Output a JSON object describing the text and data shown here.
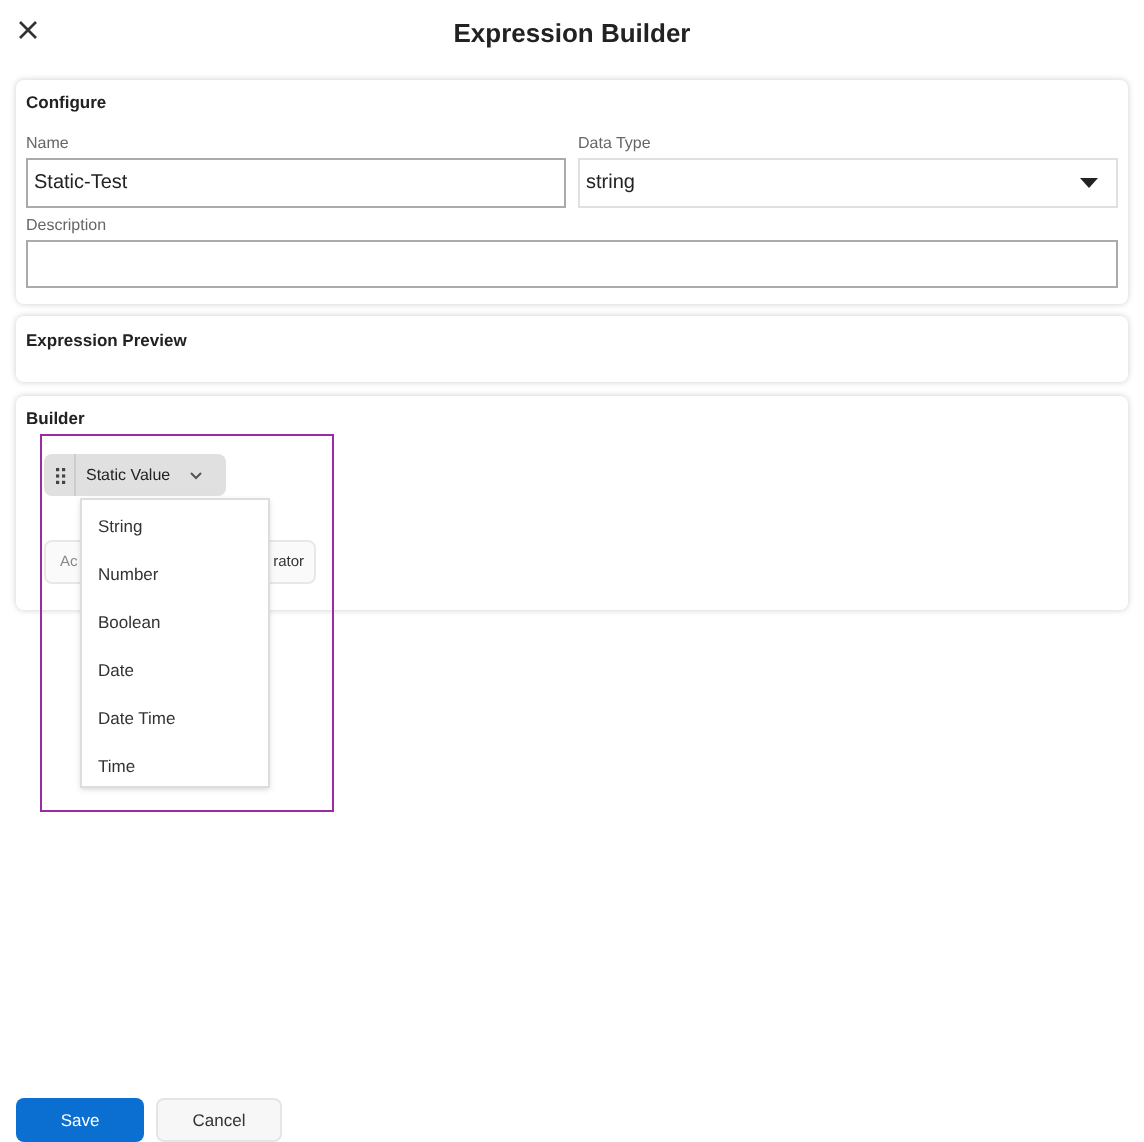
{
  "window": {
    "title": "Expression Builder"
  },
  "configure": {
    "heading": "Configure",
    "name_label": "Name",
    "name_value": "Static-Test",
    "type_label": "Data Type",
    "type_value": "string",
    "description_label": "Description"
  },
  "preview": {
    "heading": "Expression Preview"
  },
  "builder": {
    "heading": "Builder",
    "chip": "Static Value",
    "hidden_button_left": "Ac",
    "hidden_button_right": "rator",
    "menu": [
      {
        "label": "String"
      },
      {
        "label": "Number"
      },
      {
        "label": "Boolean"
      },
      {
        "label": "Date"
      },
      {
        "label": "Date Time"
      },
      {
        "label": "Time"
      }
    ]
  },
  "buttons": [
    {
      "label": "Save",
      "kind": "primary"
    },
    {
      "label": "Cancel",
      "kind": "secondary"
    }
  ]
}
